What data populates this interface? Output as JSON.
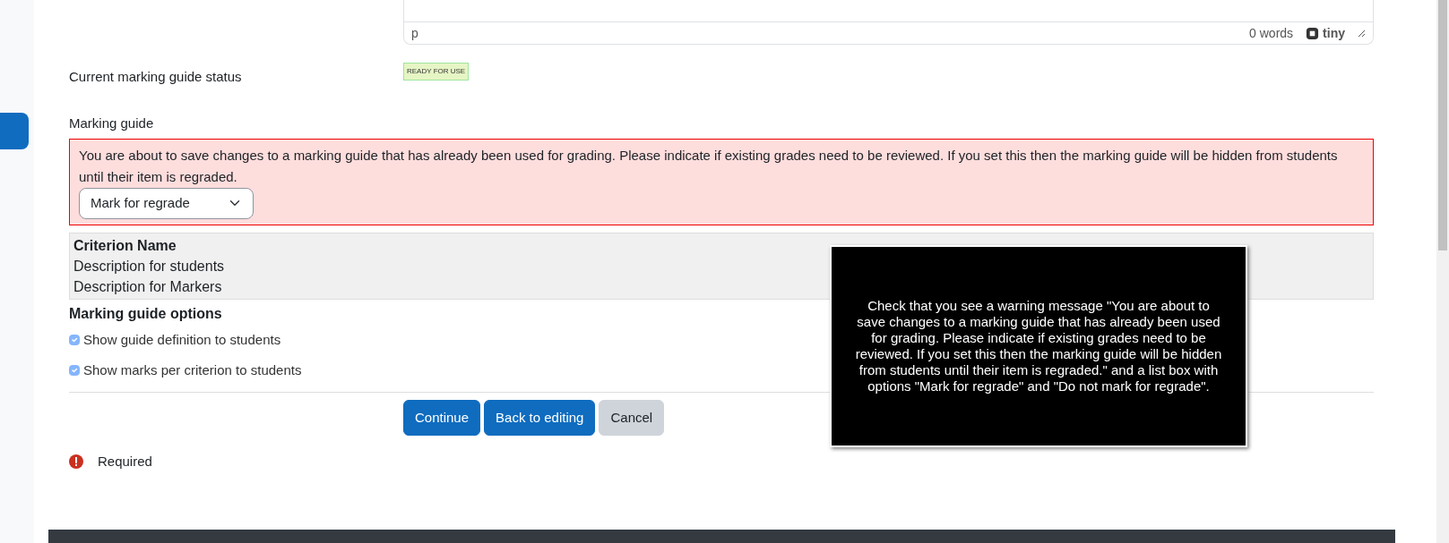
{
  "editor": {
    "path": "p",
    "word_count": "0 words",
    "brand": "tiny"
  },
  "status": {
    "label": "Current marking guide status",
    "badge": "READY FOR USE"
  },
  "marking_guide": {
    "label": "Marking guide",
    "warning": "You are about to save changes to a marking guide that has already been used for grading. Please indicate if existing grades need to be reviewed. If you set this then the marking guide will be hidden from students until their item is regraded.",
    "regrade_select": {
      "value": "Mark for regrade"
    },
    "criterion": {
      "name": "Criterion Name",
      "description_students": "Description for students",
      "description_markers": "Description for Markers"
    }
  },
  "options": {
    "heading": "Marking guide options",
    "items": [
      {
        "label": "Show guide definition to students",
        "checked": true,
        "disabled": true
      },
      {
        "label": "Show marks per criterion to students",
        "checked": true,
        "disabled": true
      }
    ]
  },
  "buttons": [
    {
      "label": "Continue",
      "kind": "primary"
    },
    {
      "label": "Back to editing",
      "kind": "primary"
    },
    {
      "label": "Cancel",
      "kind": "secondary"
    }
  ],
  "required_note": "Required",
  "tooltip": "Check that you see a warning message \"You are about to save changes to a marking guide that has already been used for grading. Please indicate if existing grades need to be reviewed. If you set this then the marking guide will be hidden from students until their item is regraded.\" and a list box with options \"Mark for regrade\" and \"Do not mark for regrade\"."
}
